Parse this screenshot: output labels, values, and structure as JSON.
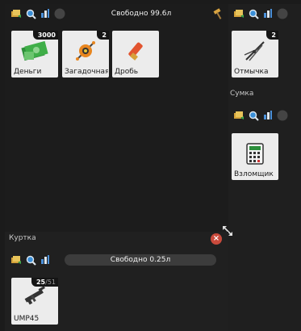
{
  "main": {
    "capacity_text": "Свободно 99.6л",
    "items": [
      {
        "label": "Деньги",
        "count": "3000",
        "icon": "money-icon"
      },
      {
        "label": "Загадочная",
        "count": "2",
        "icon": "mystery-device-icon"
      },
      {
        "label": "Дробь",
        "count": "",
        "icon": "shotgun-shell-icon"
      }
    ]
  },
  "right": {
    "top_item": {
      "label": "Отмычка",
      "count": "2",
      "icon": "lockpick-icon"
    },
    "bag_title": "Сумка",
    "bag_item": {
      "label": "Взломщик",
      "count": "",
      "icon": "hacker-device-icon"
    }
  },
  "jacket": {
    "title": "Куртка",
    "capacity_text": "Свободно 0.25л",
    "item": {
      "label": "UMP45",
      "count_current": "25",
      "count_max": "/51",
      "icon": "smg-icon"
    }
  },
  "icons": [
    "move-items-icon",
    "search-icon",
    "stats-icon",
    "sort-toggle-icon",
    "hammer-icon",
    "close-icon",
    "resize-icon"
  ]
}
